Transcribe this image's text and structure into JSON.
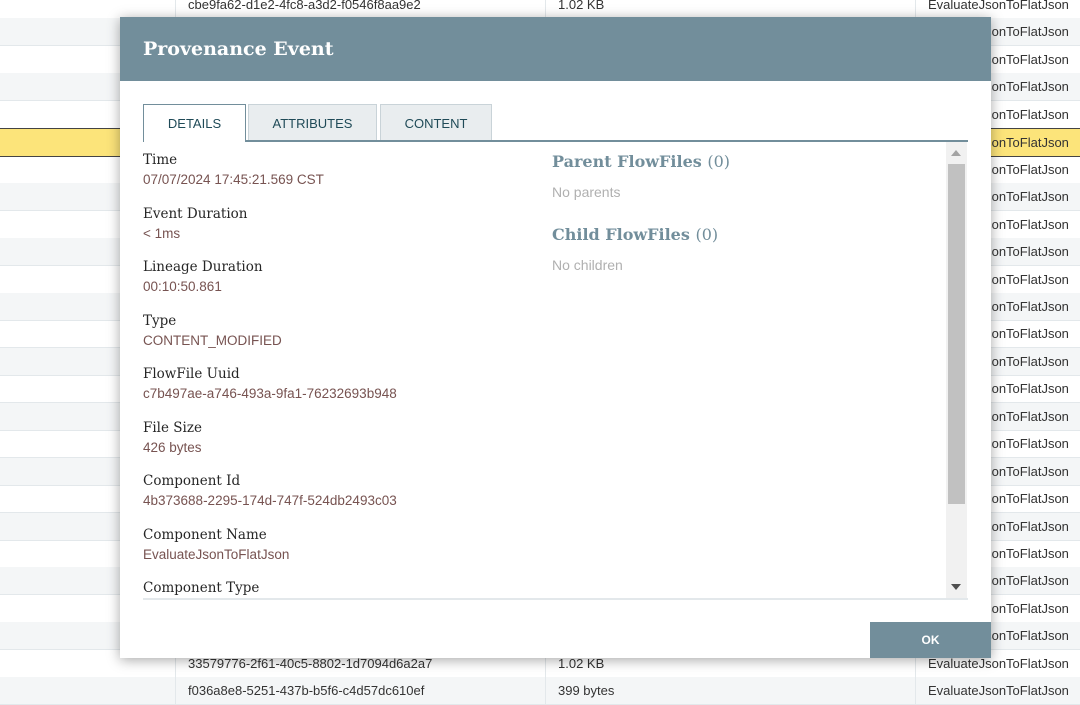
{
  "background_table": {
    "rows": [
      {
        "flowfile_uuid": "cbe9fa62-d1e2-4fc8-a3d2-f0546f8aa9e2",
        "file_size": "1.02 KB",
        "component_name": "EvaluateJsonToFlatJson"
      },
      {
        "flowfile_uuid": "",
        "file_size": "",
        "component_name": "EvaluateJsonToFlatJson"
      },
      {
        "flowfile_uuid": "",
        "file_size": "",
        "component_name": "EvaluateJsonToFlatJson"
      },
      {
        "flowfile_uuid": "",
        "file_size": "",
        "component_name": "EvaluateJsonToFlatJson"
      },
      {
        "flowfile_uuid": "",
        "file_size": "",
        "component_name": "EvaluateJsonToFlatJson"
      },
      {
        "flowfile_uuid": "",
        "file_size": "",
        "component_name": "EvaluateJsonToFlatJson",
        "selected": true
      },
      {
        "flowfile_uuid": "",
        "file_size": "",
        "component_name": "EvaluateJsonToFlatJson"
      },
      {
        "flowfile_uuid": "",
        "file_size": "",
        "component_name": "EvaluateJsonToFlatJson"
      },
      {
        "flowfile_uuid": "",
        "file_size": "",
        "component_name": "EvaluateJsonToFlatJson"
      },
      {
        "flowfile_uuid": "",
        "file_size": "",
        "component_name": "EvaluateJsonToFlatJson"
      },
      {
        "flowfile_uuid": "",
        "file_size": "",
        "component_name": "EvaluateJsonToFlatJson"
      },
      {
        "flowfile_uuid": "",
        "file_size": "",
        "component_name": "EvaluateJsonToFlatJson"
      },
      {
        "flowfile_uuid": "",
        "file_size": "",
        "component_name": "EvaluateJsonToFlatJson"
      },
      {
        "flowfile_uuid": "",
        "file_size": "",
        "component_name": "EvaluateJsonToFlatJson"
      },
      {
        "flowfile_uuid": "",
        "file_size": "",
        "component_name": "EvaluateJsonToFlatJson"
      },
      {
        "flowfile_uuid": "",
        "file_size": "",
        "component_name": "EvaluateJsonToFlatJson"
      },
      {
        "flowfile_uuid": "",
        "file_size": "",
        "component_name": "EvaluateJsonToFlatJson"
      },
      {
        "flowfile_uuid": "",
        "file_size": "",
        "component_name": "EvaluateJsonToFlatJson"
      },
      {
        "flowfile_uuid": "",
        "file_size": "",
        "component_name": "EvaluateJsonToFlatJson"
      },
      {
        "flowfile_uuid": "",
        "file_size": "",
        "component_name": "EvaluateJsonToFlatJson"
      },
      {
        "flowfile_uuid": "",
        "file_size": "",
        "component_name": "EvaluateJsonToFlatJson"
      },
      {
        "flowfile_uuid": "",
        "file_size": "",
        "component_name": "EvaluateJsonToFlatJson"
      },
      {
        "flowfile_uuid": "",
        "file_size": "",
        "component_name": "EvaluateJsonToFlatJson"
      },
      {
        "flowfile_uuid": "",
        "file_size": "",
        "component_name": "EvaluateJsonToFlatJson"
      },
      {
        "flowfile_uuid": "33579776-2f61-40c5-8802-1d7094d6a2a7",
        "file_size": "1.02 KB",
        "component_name": "EvaluateJsonToFlatJson"
      },
      {
        "flowfile_uuid": "f036a8e8-5251-437b-b5f6-c4d57dc610ef",
        "file_size": "399 bytes",
        "component_name": "EvaluateJsonToFlatJson"
      }
    ]
  },
  "dialog": {
    "title": "Provenance Event",
    "tabs": [
      {
        "label": "DETAILS",
        "active": true
      },
      {
        "label": "ATTRIBUTES",
        "active": false
      },
      {
        "label": "CONTENT",
        "active": false
      }
    ],
    "details": [
      {
        "label": "Time",
        "value": "07/07/2024 17:45:21.569 CST"
      },
      {
        "label": "Event Duration",
        "value": "< 1ms"
      },
      {
        "label": "Lineage Duration",
        "value": "00:10:50.861"
      },
      {
        "label": "Type",
        "value": "CONTENT_MODIFIED"
      },
      {
        "label": "FlowFile Uuid",
        "value": "c7b497ae-a746-493a-9fa1-76232693b948"
      },
      {
        "label": "File Size",
        "value": "426 bytes"
      },
      {
        "label": "Component Id",
        "value": "4b373688-2295-174d-747f-524db2493c03"
      },
      {
        "label": "Component Name",
        "value": "EvaluateJsonToFlatJson"
      },
      {
        "label": "Component Type",
        "value": ""
      }
    ],
    "parent_flowfiles": {
      "heading": "Parent FlowFiles",
      "count": "(0)",
      "empty_text": "No parents"
    },
    "child_flowfiles": {
      "heading": "Child FlowFiles",
      "count": "(0)",
      "empty_text": "No children"
    },
    "ok_label": "OK"
  },
  "colors": {
    "header": "#728e9b",
    "value_text": "#775351",
    "selected_row": "#fce47a"
  }
}
